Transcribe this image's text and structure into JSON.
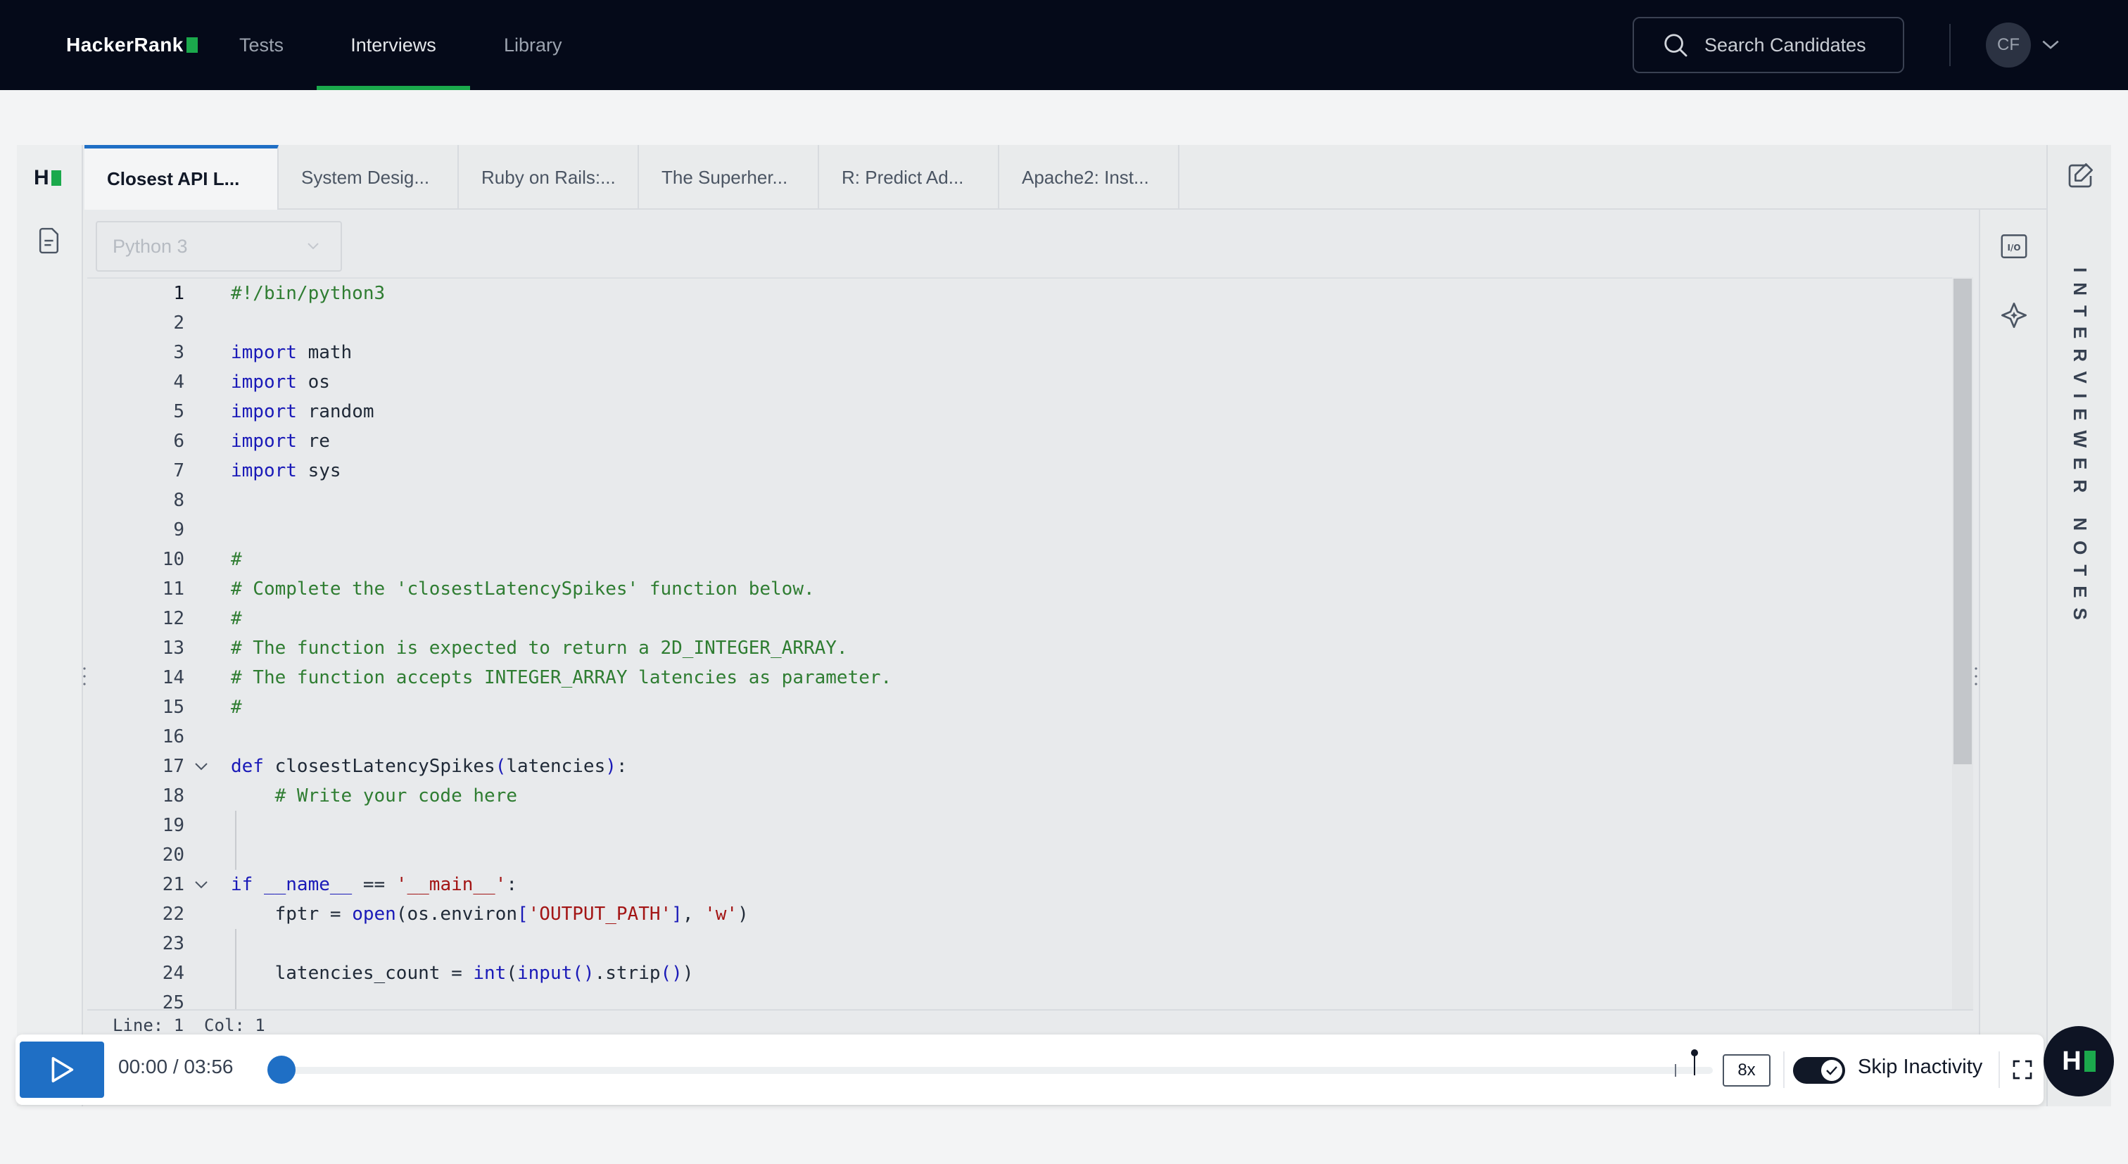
{
  "app": {
    "brand": "HackerRank",
    "accent": "#1ba94c",
    "primary": "#1f6fc5"
  },
  "nav": {
    "items": [
      {
        "label": "Tests",
        "active": false
      },
      {
        "label": "Interviews",
        "active": true
      },
      {
        "label": "Library",
        "active": false
      }
    ],
    "search_placeholder": "Search Candidates",
    "avatar_initials": "CF"
  },
  "panel": {
    "mini_logo": "H",
    "tabs": [
      {
        "label": "Closest API L...",
        "active": true
      },
      {
        "label": "System Desig...",
        "active": false
      },
      {
        "label": "Ruby on Rails:...",
        "active": false
      },
      {
        "label": "The Superher...",
        "active": false
      },
      {
        "label": "R: Predict Ad...",
        "active": false
      },
      {
        "label": "Apache2: Inst...",
        "active": false
      }
    ],
    "language": "Python 3",
    "status": "Line: 1  Col: 1",
    "notes_label": "INTERVIEWER NOTES"
  },
  "code": {
    "line_numbers": [
      "1",
      "2",
      "3",
      "4",
      "5",
      "6",
      "7",
      "8",
      "9",
      "10",
      "11",
      "12",
      "13",
      "14",
      "15",
      "16",
      "17",
      "18",
      "19",
      "20",
      "21",
      "22",
      "23",
      "24",
      "25"
    ],
    "current_line": 1
  },
  "player": {
    "time": "00:00 / 03:56",
    "progress": 0,
    "speed": "8x",
    "skip_inactivity_label": "Skip Inactivity",
    "skip_inactivity_on": true
  },
  "fab": {
    "label": "H"
  }
}
